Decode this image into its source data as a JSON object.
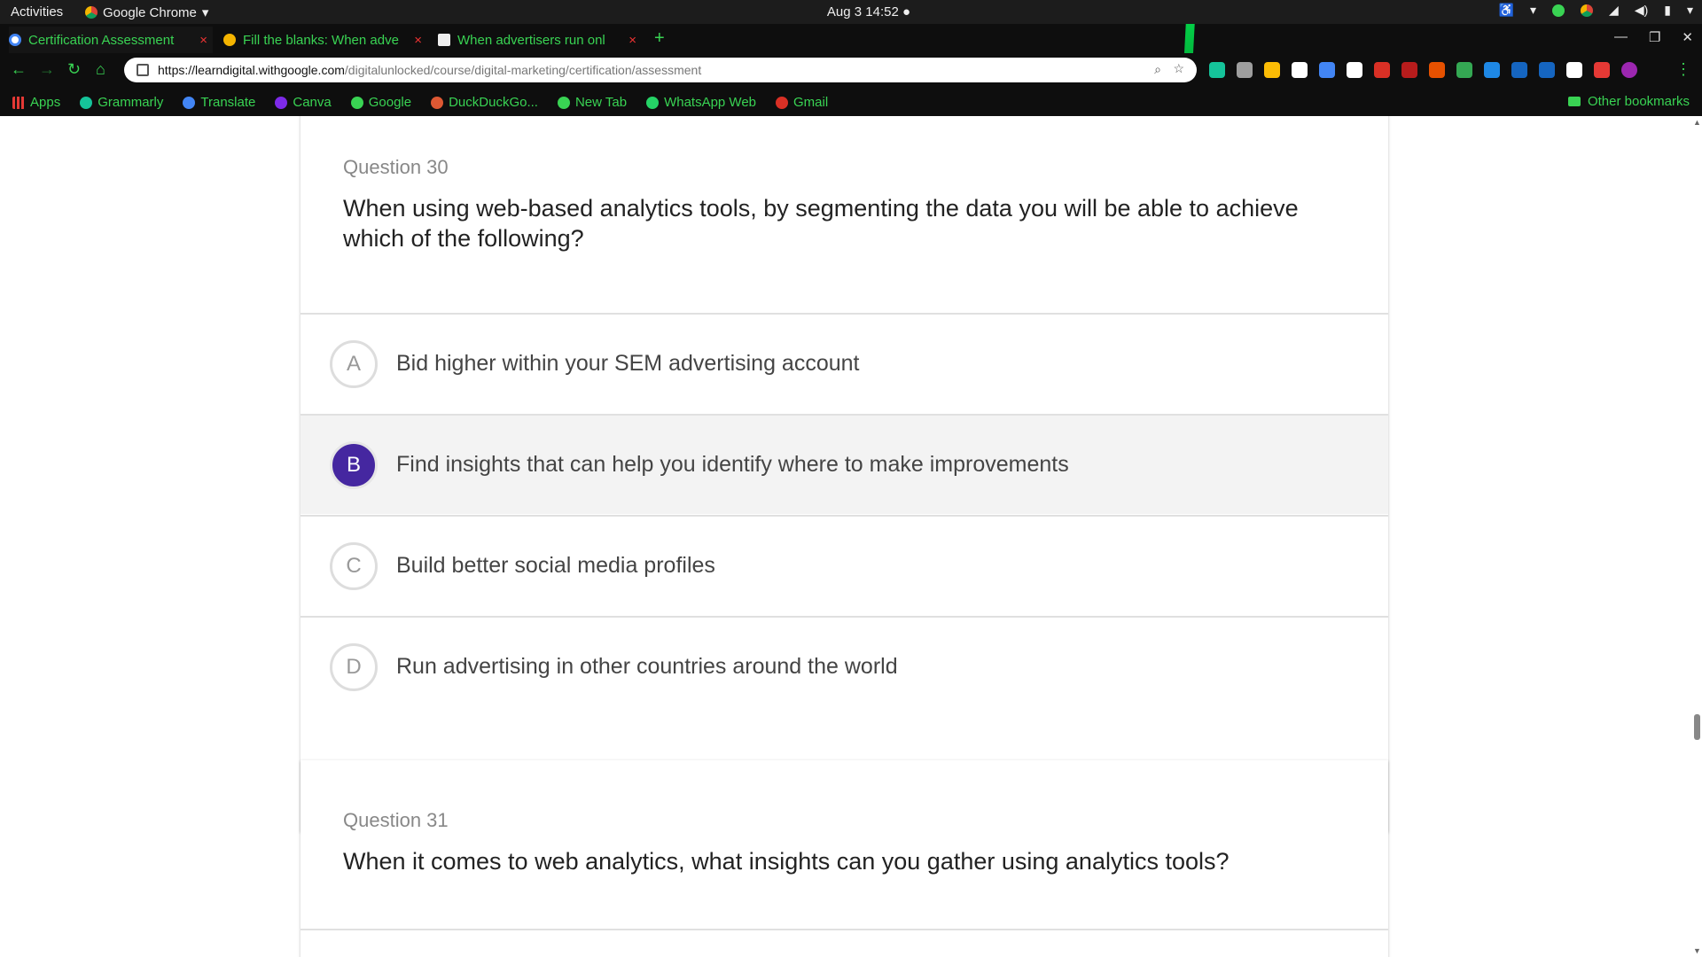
{
  "system_bar": {
    "activities": "Activities",
    "app_name": "Google Chrome",
    "clock": "Aug 3  14:52 ●"
  },
  "tabs": [
    {
      "title": "Certification Assessment",
      "favicon_color": "#4285f4",
      "active": true
    },
    {
      "title": "Fill the blanks: When adve",
      "favicon_color": "#f4b400",
      "active": false
    },
    {
      "title": "When advertisers run onl",
      "favicon_color": "#eeeeee",
      "active": false
    }
  ],
  "tab_close_glyph": "×",
  "new_tab_glyph": "+",
  "address_bar": {
    "host": "https://learndigital.withgoogle.com",
    "path": "/digitalunlocked/course/digital-marketing/certification/assessment"
  },
  "bookmarks": [
    {
      "label": "Apps",
      "icon": "apps-grid-icon",
      "color": "#e53935"
    },
    {
      "label": "Grammarly",
      "icon": "grammarly-icon",
      "color": "#15c39a"
    },
    {
      "label": "Translate",
      "icon": "translate-icon",
      "color": "#4285f4"
    },
    {
      "label": "Canva",
      "icon": "canva-icon",
      "color": "#7d2ae8"
    },
    {
      "label": "Google",
      "icon": "google-icon",
      "color": "#39d353"
    },
    {
      "label": "DuckDuckGo...",
      "icon": "duckduckgo-icon",
      "color": "#de5833"
    },
    {
      "label": "New Tab",
      "icon": "newtab-icon",
      "color": "#39d353"
    },
    {
      "label": "WhatsApp Web",
      "icon": "whatsapp-icon",
      "color": "#25d366"
    },
    {
      "label": "Gmail",
      "icon": "gmail-icon",
      "color": "#d93025"
    }
  ],
  "other_bookmarks": "Other bookmarks",
  "extension_colors": [
    "#15c39a",
    "#9e9e9e",
    "#fbbc05",
    "#ffffff",
    "#4285f4",
    "#ffffff",
    "#d93025",
    "#b71c1c",
    "#e65100",
    "#34a853",
    "#1e88e5",
    "#1565c0",
    "#1565c0",
    "#ffffff",
    "#e53935",
    "#9c27b0"
  ],
  "question_30": {
    "number": "Question 30",
    "text": "When using web-based analytics tools, by segmenting the data you will be able to achieve which of the following?",
    "options": [
      {
        "letter": "A",
        "text": "Bid higher within your SEM advertising account",
        "selected": false
      },
      {
        "letter": "B",
        "text": "Find insights that can help you identify where to make improvements",
        "selected": true
      },
      {
        "letter": "C",
        "text": "Build better social media profiles",
        "selected": false
      },
      {
        "letter": "D",
        "text": "Run advertising in other countries around the world",
        "selected": false
      }
    ]
  },
  "question_31": {
    "number": "Question 31",
    "text": "When it comes to web analytics, what insights can you gather using analytics tools?"
  },
  "accent_color": "#4527a0"
}
